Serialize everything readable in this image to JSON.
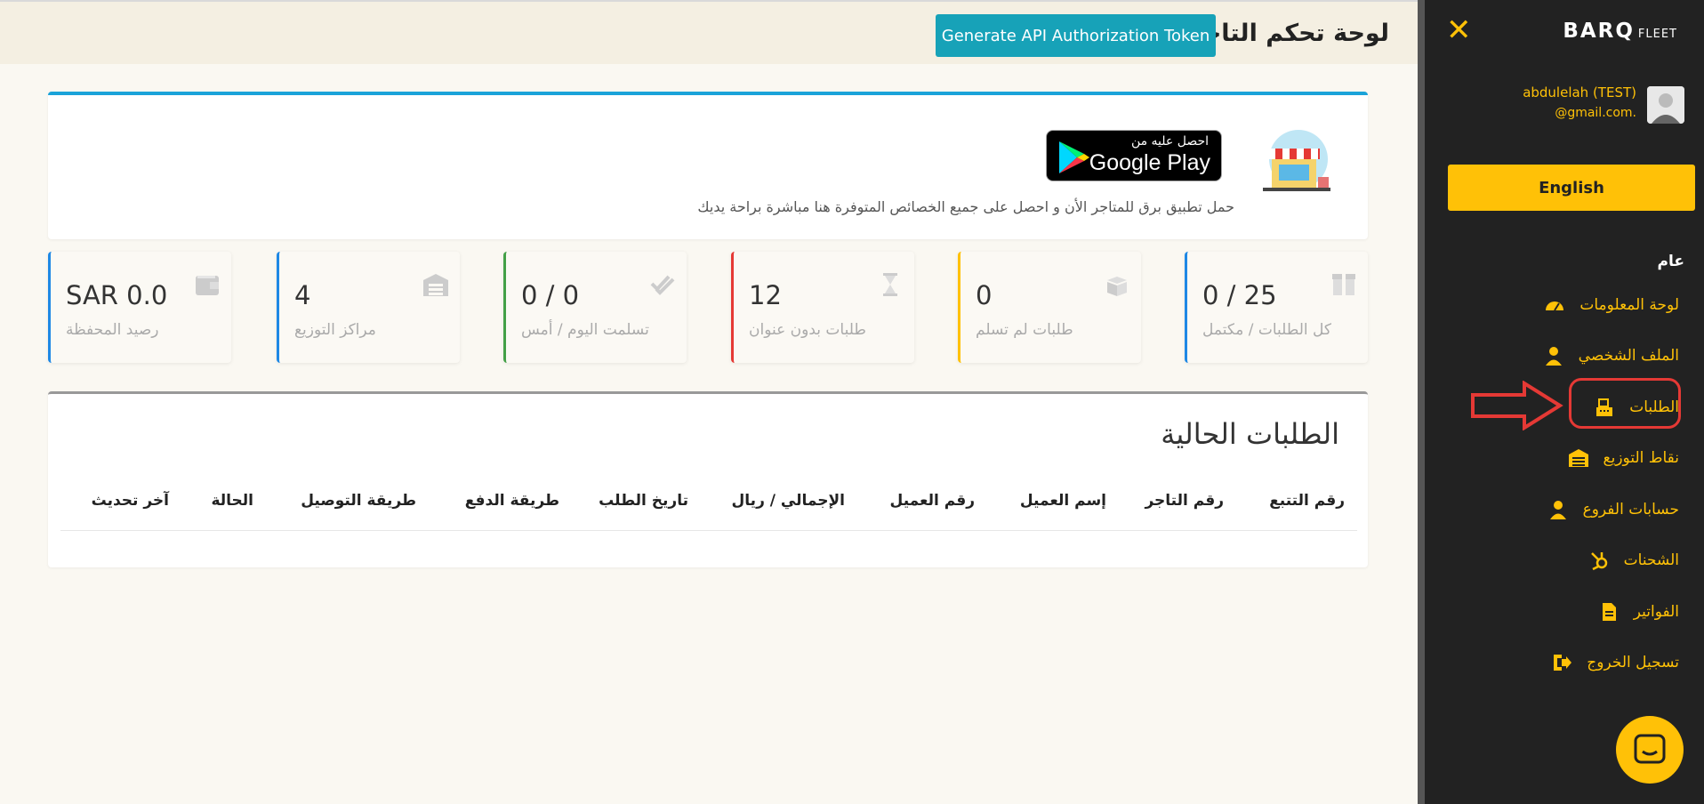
{
  "header": {
    "title": "لوحة تحكم التاجر",
    "api_button": "Generate API Authorization Token"
  },
  "banner": {
    "gplay_small": "احصل عليه من",
    "gplay_big": "Google Play",
    "text": "حمل تطبيق برق للمتاجر الأن و احصل على جميع الخصائص المتوفرة هنا مباشرة براحة يديك"
  },
  "cards": [
    {
      "value": "0 / 25",
      "label": "كل الطلبات / مكتمل",
      "color": "#1e88e5",
      "icon": "box-icon"
    },
    {
      "value": "0",
      "label": "طلبات لم تسلم",
      "color": "#ffc107",
      "icon": "open-box-icon"
    },
    {
      "value": "12",
      "label": "طلبات بدون عنوان",
      "color": "#e53935",
      "icon": "hourglass-icon"
    },
    {
      "value": "0 / 0",
      "label": "تسلمت اليوم / أمس",
      "color": "#43a047",
      "icon": "double-check-icon"
    },
    {
      "value": "4",
      "label": "مراكز التوزيع",
      "color": "#1e88e5",
      "icon": "warehouse-icon"
    },
    {
      "value": "SAR 0.0",
      "label": "رصيد المحفظة",
      "color": "#1e88e5",
      "icon": "wallet-icon"
    }
  ],
  "orders": {
    "title": "الطلبات الحالية",
    "columns": [
      "رقم التتبع",
      "رقم التاجر",
      "إسم العميل",
      "رقم العميل",
      "الإجمالي / ريال",
      "تاريخ الطلب",
      "طريقة الدفع",
      "طريقة التوصيل",
      "الحالة",
      "آخر تحديث"
    ]
  },
  "sidebar": {
    "logo": "BARQ",
    "logo_sub": "FLEET",
    "user_name": "abdulelah (TEST)",
    "user_email": "@gmail.com.",
    "language_button": "English",
    "section": "عام",
    "items": [
      {
        "label": "لوحة المعلومات",
        "icon": "dashboard-icon"
      },
      {
        "label": "الملف الشخصي",
        "icon": "user-icon"
      },
      {
        "label": "الطلبات",
        "icon": "register-icon"
      },
      {
        "label": "نقاط التوزيع",
        "icon": "warehouse-icon"
      },
      {
        "label": "حسابات الفروع",
        "icon": "user-icon"
      },
      {
        "label": "الشحنات",
        "icon": "hubspot-icon"
      },
      {
        "label": "الفواتير",
        "icon": "invoice-icon"
      },
      {
        "label": "تسجيل الخروج",
        "icon": "logout-icon"
      }
    ]
  },
  "colors": {
    "accent": "#ffc107",
    "sidebar_bg": "#222222",
    "api_button": "#17a2b8",
    "highlight": "#e53935"
  }
}
